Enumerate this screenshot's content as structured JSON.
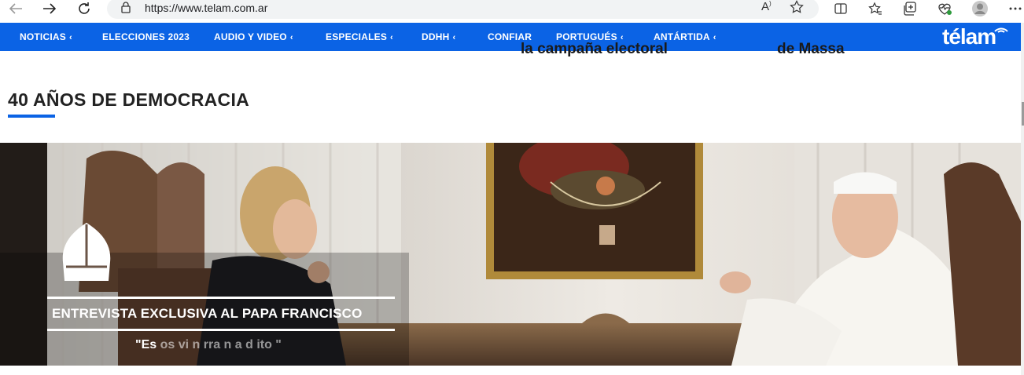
{
  "browser": {
    "url": "https://www.telam.com.ar"
  },
  "nav": {
    "items": [
      {
        "label": "NOTICIAS",
        "has_chevron": true
      },
      {
        "label": "ELECCIONES 2023",
        "has_chevron": false
      },
      {
        "label": "AUDIO Y VIDEO",
        "has_chevron": true
      },
      {
        "label": "ESPECIALES",
        "has_chevron": true
      },
      {
        "label": "DDHH",
        "has_chevron": true
      },
      {
        "label": "CONFIAR",
        "has_chevron": false
      },
      {
        "label": "PORTUGUÉS",
        "has_chevron": true
      },
      {
        "label": "ANTÁRTIDA",
        "has_chevron": true
      }
    ],
    "chevron": "‹",
    "logo": "télam"
  },
  "cut_headlines": {
    "left": "la campaña electoral",
    "right": "de Massa"
  },
  "section": {
    "title": "40 AÑOS DE DEMOCRACIA"
  },
  "hero": {
    "title": "ENTREVISTA EXCLUSIVA AL PAPA FRANCISCO",
    "quote_visible": "\"Es",
    "quote_faded": "os vi n rra n a d ito \""
  },
  "colors": {
    "nav_blue": "#0b63e5",
    "accent_underline": "#0b63e5"
  }
}
